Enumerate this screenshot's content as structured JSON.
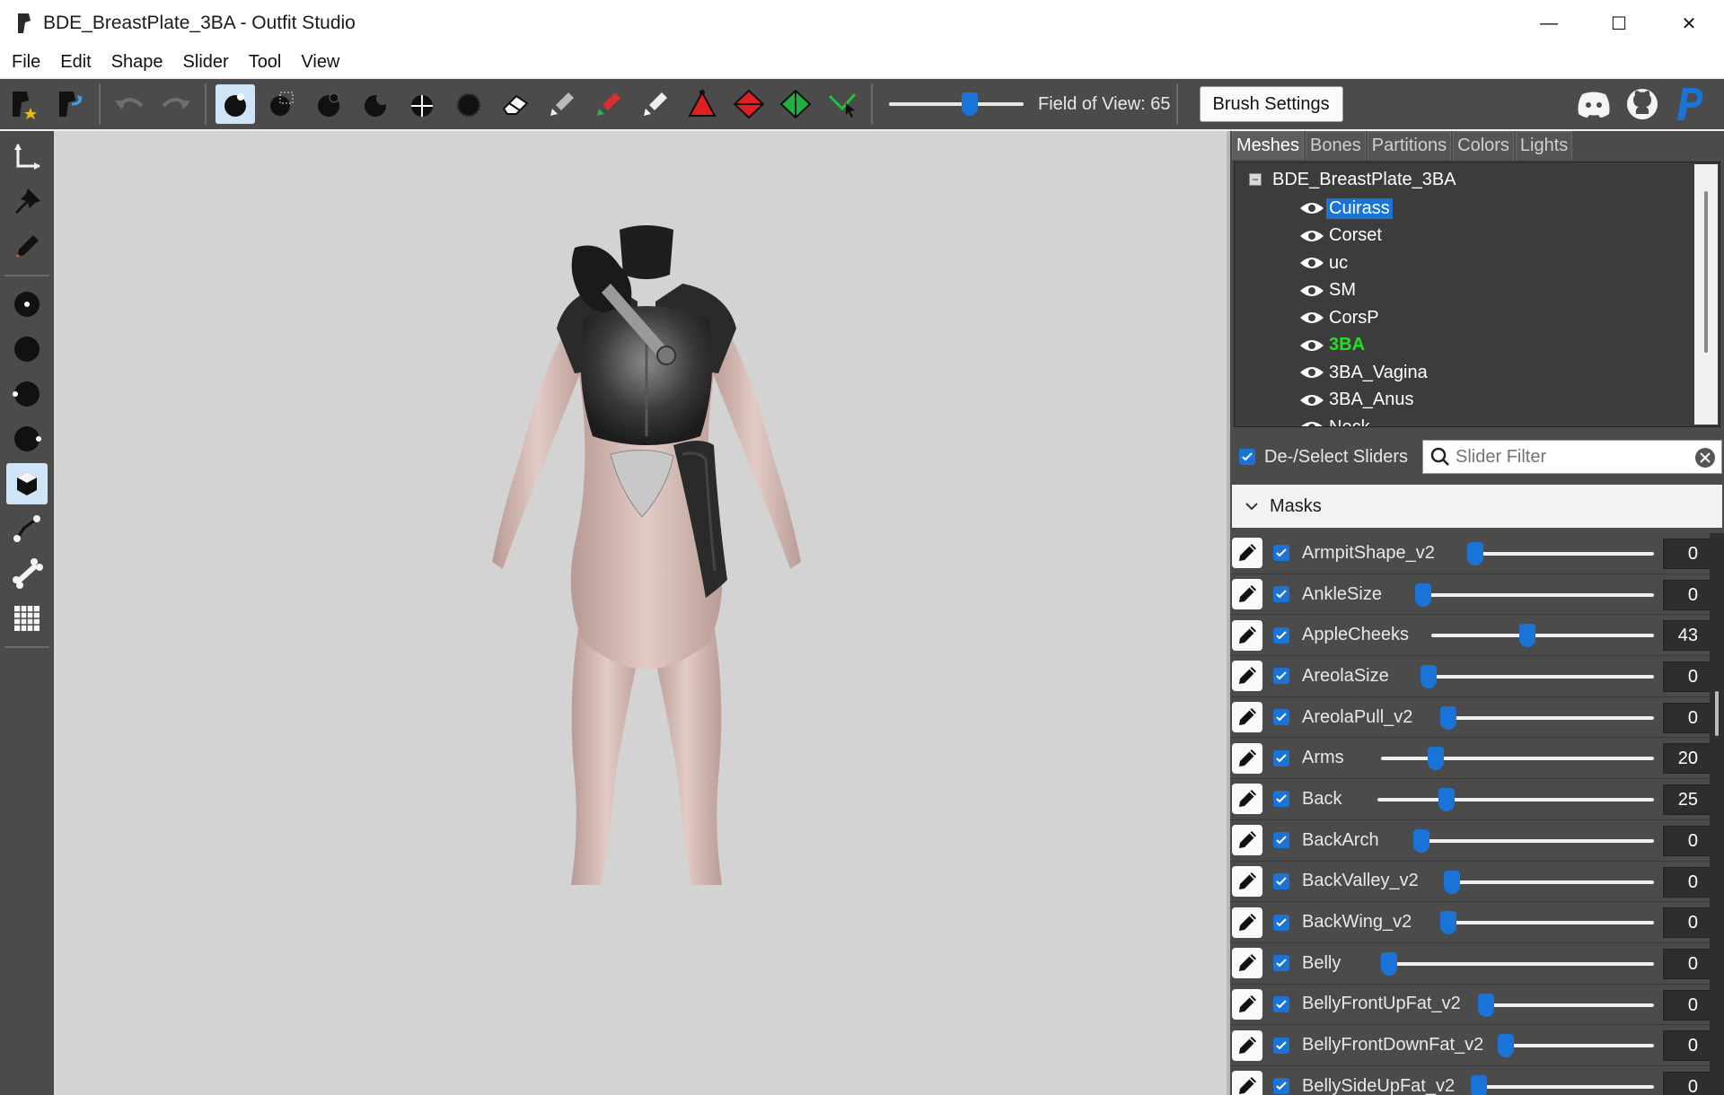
{
  "window": {
    "title": "BDE_BreastPlate_3BA - Outfit Studio",
    "minimize": "—",
    "maximize": "☐",
    "close": "✕"
  },
  "menu": [
    "File",
    "Edit",
    "Shape",
    "Slider",
    "Tool",
    "View"
  ],
  "toolbar": {
    "fov_label": "Field of View: 65",
    "fov_value": 65,
    "brush_settings_label": "Brush Settings"
  },
  "tabs": [
    {
      "label": "Meshes",
      "active": true
    },
    {
      "label": "Bones",
      "active": false
    },
    {
      "label": "Partitions",
      "active": false
    },
    {
      "label": "Colors",
      "active": false
    },
    {
      "label": "Lights",
      "active": false
    }
  ],
  "mesh_tree": {
    "root": "BDE_BreastPlate_3BA",
    "toggle": "−",
    "items": [
      {
        "label": "Cuirass",
        "selected": true
      },
      {
        "label": "Corset"
      },
      {
        "label": "uc"
      },
      {
        "label": "SM"
      },
      {
        "label": "CorsP"
      },
      {
        "label": "3BA",
        "highlight": "#22e022"
      },
      {
        "label": "3BA_Vagina"
      },
      {
        "label": "3BA_Anus"
      },
      {
        "label": "Neck"
      }
    ]
  },
  "slider_panel": {
    "deselect_label": "De-/Select Sliders",
    "filter_placeholder": "Slider Filter",
    "masks_label": "Masks"
  },
  "sliders": [
    {
      "name": "ArmpitShape_v2",
      "value": "0",
      "level": 0.0
    },
    {
      "name": "AnkleSize",
      "value": "0",
      "level": 0.0
    },
    {
      "name": "AppleCheeks",
      "value": "43",
      "level": 0.43
    },
    {
      "name": "AreolaSize",
      "value": "0",
      "level": 0.0
    },
    {
      "name": "AreolaPull_v2",
      "value": "0",
      "level": 0.0
    },
    {
      "name": "Arms",
      "value": "20",
      "level": 0.2
    },
    {
      "name": "Back",
      "value": "25",
      "level": 0.25
    },
    {
      "name": "BackArch",
      "value": "0",
      "level": 0.0
    },
    {
      "name": "BackValley_v2",
      "value": "0",
      "level": 0.0
    },
    {
      "name": "BackWing_v2",
      "value": "0",
      "level": 0.0
    },
    {
      "name": "Belly",
      "value": "0",
      "level": 0.0
    },
    {
      "name": "BellyFrontUpFat_v2",
      "value": "0",
      "level": 0.0
    },
    {
      "name": "BellyFrontDownFat_v2",
      "value": "0",
      "level": 0.0
    },
    {
      "name": "BellySideUpFat_v2",
      "value": "0",
      "level": 0.0
    }
  ],
  "colors": {
    "accent": "#1a73d6",
    "panel": "#4b4b4b",
    "viewport": "#d3d3d3",
    "highlight_green": "#22e022"
  }
}
